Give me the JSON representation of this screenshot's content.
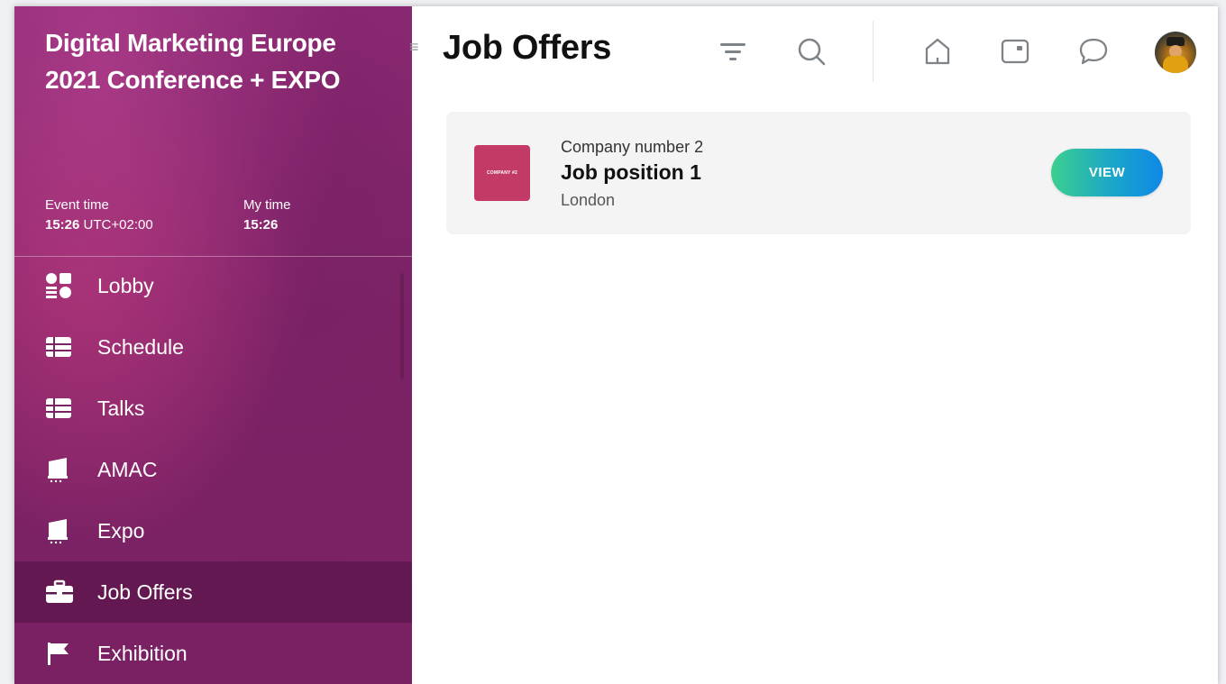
{
  "event": {
    "title": "Digital Marketing Europe 2021 Conference + EXPO",
    "event_time_label": "Event time",
    "event_time_value": "15:26",
    "event_time_zone": " UTC+02:00",
    "my_time_label": "My time",
    "my_time_value": "15:26"
  },
  "sidebar": {
    "items": [
      {
        "label": "Lobby",
        "icon": "lobby-icon"
      },
      {
        "label": "Schedule",
        "icon": "list-icon"
      },
      {
        "label": "Talks",
        "icon": "list-icon"
      },
      {
        "label": "AMAC",
        "icon": "stage-icon"
      },
      {
        "label": "Expo",
        "icon": "stage-icon"
      },
      {
        "label": "Job Offers",
        "icon": "briefcase-icon",
        "active": true
      },
      {
        "label": "Exhibition",
        "icon": "flag-icon"
      }
    ]
  },
  "header": {
    "title": "Job Offers",
    "icons": [
      "filter-icon",
      "search-icon",
      "home-icon",
      "wallet-icon",
      "chat-icon",
      "avatar"
    ]
  },
  "job_offers": [
    {
      "company": "Company number 2",
      "logo_text": "COMPANY #2",
      "title": "Job position 1",
      "location": "London",
      "action_label": "VIEW"
    }
  ],
  "colors": {
    "sidebar_bg": "#7c2366",
    "logo_bg": "#c43a66",
    "view_button_start": "#3ccf8e",
    "view_button_end": "#0f88e6"
  }
}
